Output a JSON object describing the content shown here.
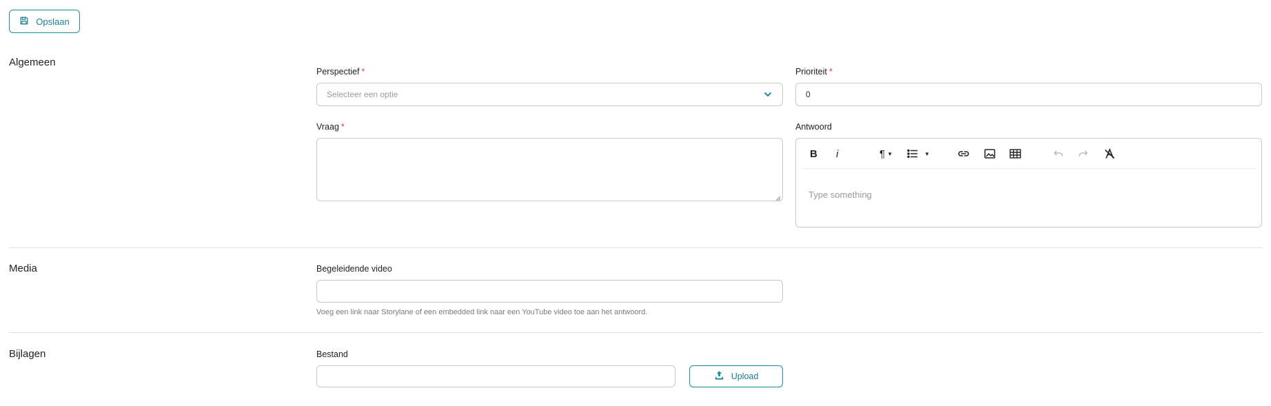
{
  "toolbar": {
    "save_label": "Opslaan",
    "save_icon": "floppy-disk-icon"
  },
  "sections": {
    "general": {
      "title": "Algemeen",
      "perspective": {
        "label": "Perspectief",
        "required_mark": "*",
        "placeholder": "Selecteer een optie"
      },
      "priority": {
        "label": "Prioriteit",
        "required_mark": "*",
        "value": "0"
      },
      "question": {
        "label": "Vraag",
        "required_mark": "*",
        "value": ""
      },
      "answer": {
        "label": "Antwoord",
        "placeholder": "Type something",
        "tools": [
          "bold-icon",
          "italic-icon",
          "paragraph-icon",
          "list-icon",
          "link-icon",
          "image-icon",
          "table-icon",
          "undo-icon",
          "redo-icon",
          "clear-format-icon"
        ],
        "bold_glyph": "B",
        "italic_glyph": "i",
        "paragraph_glyph": "¶"
      }
    },
    "media": {
      "title": "Media",
      "video": {
        "label": "Begeleidende video",
        "value": "",
        "hint": "Voeg een link naar Storylane of een embedded link naar een YouTube video toe aan het antwoord."
      }
    },
    "attachments": {
      "title": "Bijlagen",
      "file": {
        "label": "Bestand",
        "value": ""
      },
      "upload_label": "Upload",
      "upload_icon": "upload-icon"
    }
  },
  "colors": {
    "accent": "#1b8a9a",
    "required": "#e53935",
    "border": "#c9c9c9"
  }
}
